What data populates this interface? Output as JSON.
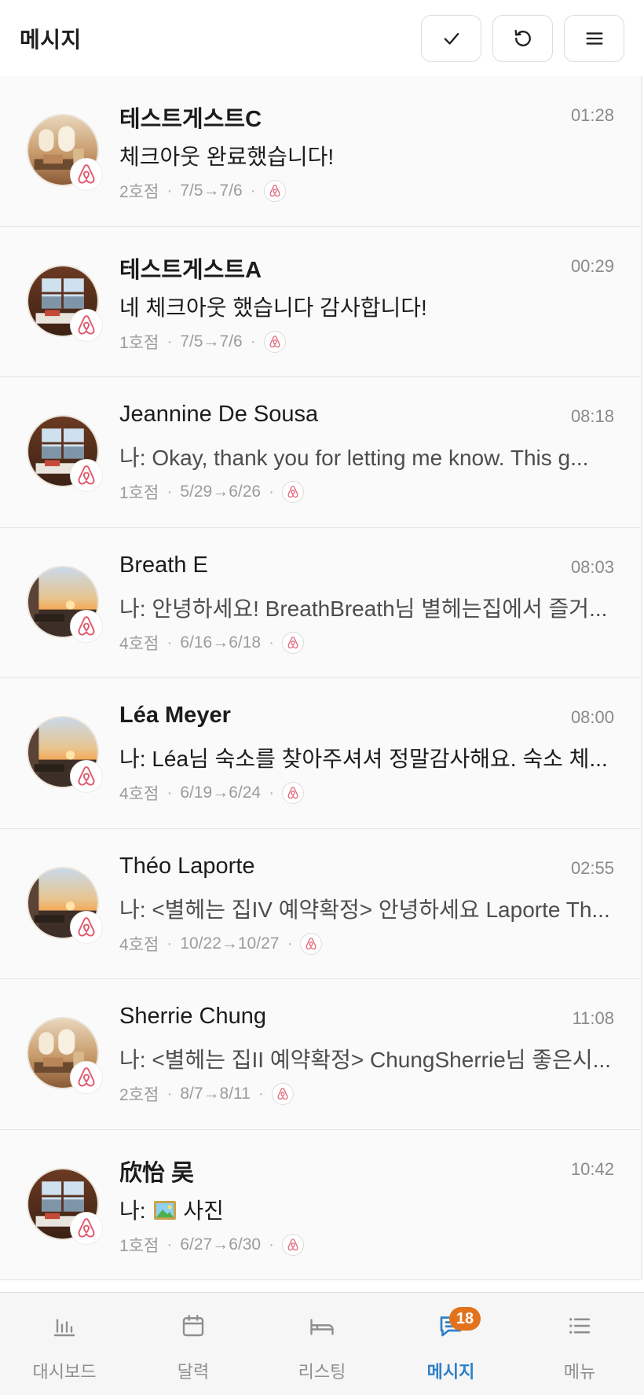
{
  "header": {
    "title": "메시지"
  },
  "colors": {
    "accent": "#2f80c9",
    "badge": "#e2731c",
    "airbnb": "#e05a6e"
  },
  "conversations": [
    {
      "name": "테스트게스트C",
      "time": "01:28",
      "preview": "체크아웃 완료했습니다!",
      "listing": "2호점",
      "dates": "7/5→7/6",
      "unread": true,
      "channel": "airbnb-icon",
      "avatar": "interior-warm"
    },
    {
      "name": "테스트게스트A",
      "time": "00:29",
      "preview": "네 체크아웃 했습니다 감사합니다!",
      "listing": "1호점",
      "dates": "7/5→7/6",
      "unread": true,
      "channel": "airbnb-icon",
      "avatar": "interior-window"
    },
    {
      "name": "Jeannine De Sousa",
      "time": "08:18",
      "preview": "나: Okay, thank you for letting me know. This g...",
      "listing": "1호점",
      "dates": "5/29→6/26",
      "unread": false,
      "channel": "airbnb-icon",
      "avatar": "interior-window"
    },
    {
      "name": "Breath E",
      "time": "08:03",
      "preview": "나: 안녕하세요! BreathBreath님 별헤는집에서 즐거...",
      "listing": "4호점",
      "dates": "6/16→6/18",
      "unread": false,
      "channel": "airbnb-icon",
      "avatar": "sunset-view"
    },
    {
      "name": "Léa Meyer",
      "time": "08:00",
      "preview": "나: Léa님 숙소를 찾아주셔셔 정말감사해요. 숙소 체...",
      "listing": "4호점",
      "dates": "6/19→6/24",
      "unread": true,
      "channel": "airbnb-icon",
      "avatar": "sunset-view"
    },
    {
      "name": "Théo Laporte",
      "time": "02:55",
      "preview": "나: <별헤는 집IV 예약확정> 안녕하세요 Laporte Th...",
      "listing": "4호점",
      "dates": "10/22→10/27",
      "unread": false,
      "channel": "airbnb-icon",
      "avatar": "sunset-view"
    },
    {
      "name": "Sherrie Chung",
      "time": "11:08",
      "preview": "나: <별헤는 집II 예약확정> ChungSherrie님 좋은시...",
      "listing": "2호점",
      "dates": "8/7→8/11",
      "unread": false,
      "channel": "airbnb-icon",
      "avatar": "interior-warm"
    },
    {
      "name": "欣怡 吴",
      "time": "10:42",
      "preview_prefix": "나: ",
      "preview_suffix": "사진",
      "listing": "1호점",
      "dates": "6/27→6/30",
      "unread": true,
      "channel": "airbnb-icon",
      "avatar": "interior-window"
    }
  ],
  "nav": {
    "items": [
      {
        "label": "대시보드",
        "icon": "bar-chart-icon"
      },
      {
        "label": "달력",
        "icon": "calendar-icon"
      },
      {
        "label": "리스팅",
        "icon": "bed-icon"
      },
      {
        "label": "메시지",
        "icon": "chat-icon",
        "active": true,
        "badge": "18"
      },
      {
        "label": "메뉴",
        "icon": "list-icon"
      }
    ]
  }
}
